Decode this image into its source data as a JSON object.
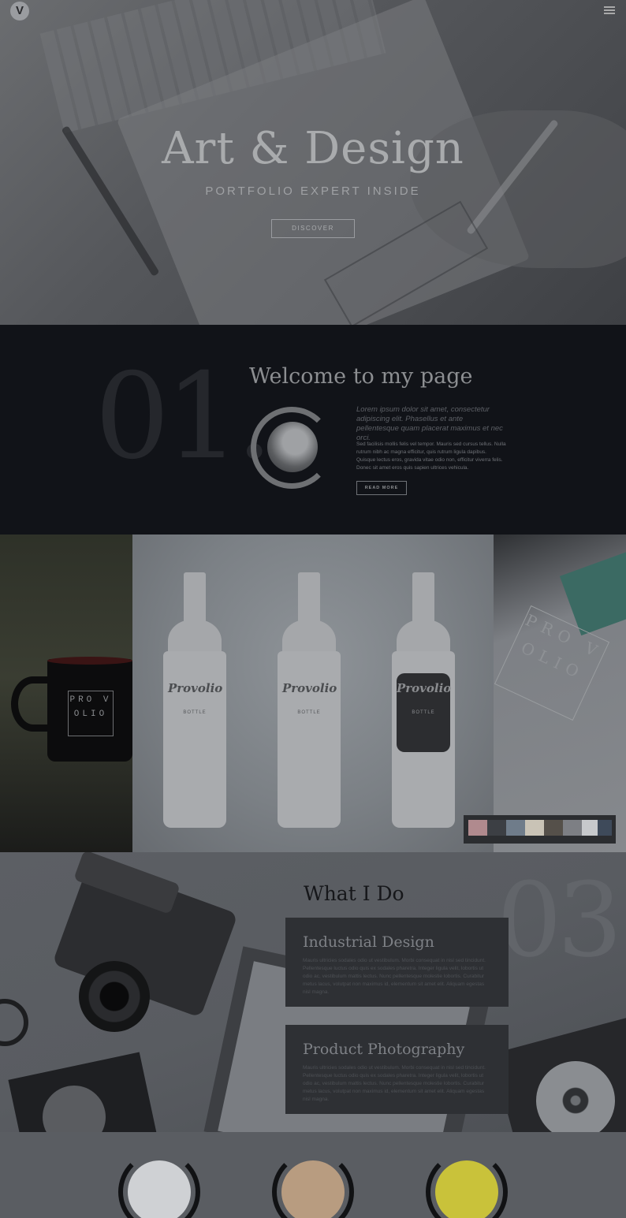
{
  "header": {
    "logo_letter": "V",
    "menu_icon": "hamburger-icon"
  },
  "hero": {
    "title": "Art  & Design",
    "subtitle": "PORTFOLIO EXPERT INSIDE",
    "button": "DISCOVER"
  },
  "welcome": {
    "number": "01.",
    "title": "Welcome to my page",
    "lead": "Lorem ipsum dolor sit amet, consectetur adipiscing elit. Phasellus et ante pellentesque quam placerat maximus et nec orci.",
    "body": "Sed facilisis mollis felis vel tempor. Mauris sed cursus tellus. Nulla rutrum nibh ac magna efficitur, quis rutrum ligula dapibus. Quisque lectus eros, gravida vitae odio non, efficitur viverra felis. Donec sit amet eros quis sapien ultrices vehicula.",
    "button": "READ MORE"
  },
  "slider": {
    "mug_text": "PRO V OLIO",
    "bottles": [
      {
        "brand": "Provolio",
        "sub": "BOTTLE"
      },
      {
        "brand": "Provolio",
        "sub": "BOTTLE"
      },
      {
        "brand": "Provolio",
        "sub": "BOTTLE"
      }
    ],
    "emboss_text": "PRO V OLIO",
    "thumbnails": [
      "#b08a8e",
      "#3c3f44",
      "#6f7c8a",
      "#c9c3b6",
      "#55504a",
      "#7d7f84",
      "#c7c9cc",
      "#3e4a5a"
    ]
  },
  "whatido": {
    "number": "03.",
    "title": "What I Do",
    "services": [
      {
        "title": "Industrial Design",
        "text": "Mauris ultricies sodales odio ut vestibulum. Morbi consequat in nisl sed tincidunt. Pellentesque luctus odio quis ex sodales pharetra. Integer ligula velit, lobortis ut odio ac, vestibulum mattis lectus. Nunc pellentesque molestie lobortis. Curabitur metus lacus, volutpat non maximus id, elementum sit amet elit. Aliquam egestas nisl magna."
      },
      {
        "title": "Product Photography",
        "text": "Mauris ultricies sodales odio ut vestibulum. Morbi consequat in nisl sed tincidunt. Pellentesque luctus odio quis ex sodales pharetra. Integer ligula velit, lobortis ut odio ac, vestibulum mattis lectus. Nunc pellentesque molestie lobortis. Curabitur metus lacus, volutpat non maximus id, elementum sit amet elit. Aliquam egestas nisl magna."
      }
    ]
  },
  "footer_circles": [
    "#cfd1d4",
    "#b89c80",
    "#c9c23a"
  ]
}
